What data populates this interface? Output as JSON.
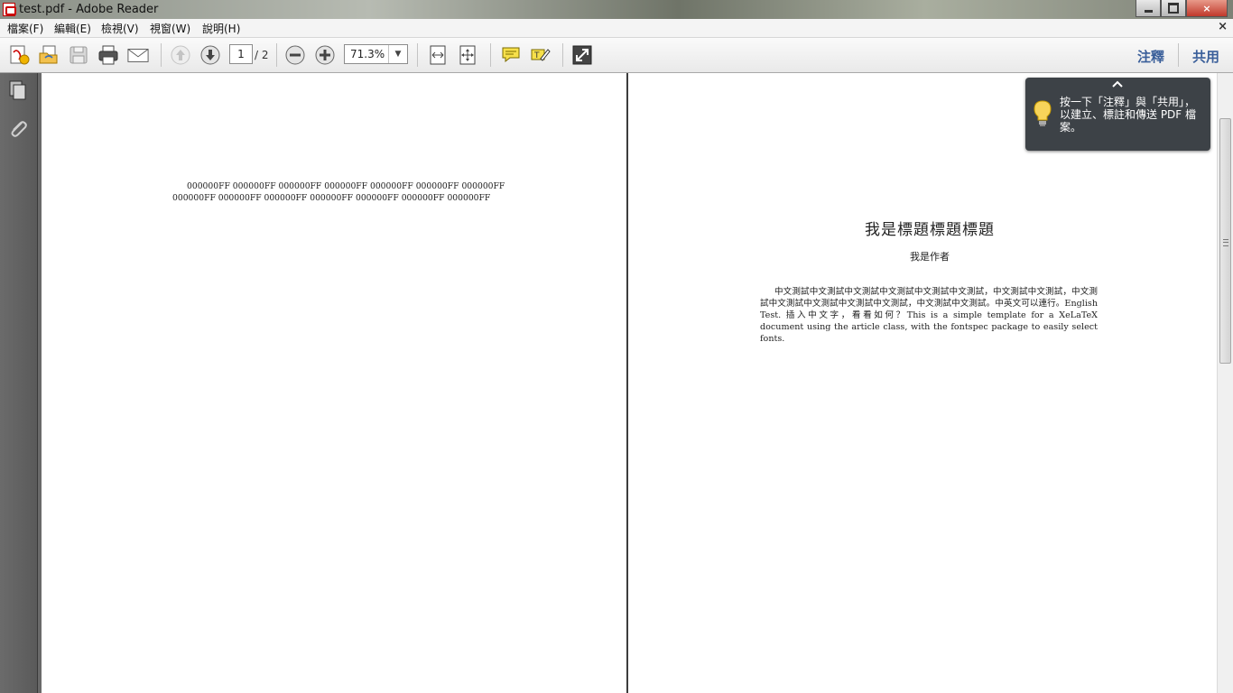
{
  "window": {
    "title": "test.pdf - Adobe Reader",
    "close_glyph": "×"
  },
  "menu": {
    "items": [
      "檔案(F)",
      "編輯(E)",
      "檢視(V)",
      "視窗(W)",
      "說明(H)"
    ],
    "close_glyph": "×"
  },
  "toolbar": {
    "page_current": "1",
    "page_total": "/ 2",
    "zoom": "71.3%",
    "comment_label": "注釋",
    "share_label": "共用",
    "icons": [
      "create-pdf-icon",
      "open-folder-icon",
      "save-icon",
      "print-icon",
      "email-icon",
      "previous-page-icon",
      "next-page-icon",
      "zoom-out-icon",
      "zoom-in-icon",
      "fit-width-icon",
      "fit-page-icon",
      "comment-icon",
      "highlight-icon",
      "full-screen-icon"
    ]
  },
  "navpane": {
    "icons": [
      "pages-icon",
      "attachments-icon"
    ]
  },
  "document": {
    "page1_text": "000000FF 000000FF 000000FF 000000FF 000000FF 000000FF 000000FF 000000FF 000000FF 000000FF 000000FF 000000FF 000000FF 000000FF",
    "page2_title": "我是標題標題標題",
    "page2_author": "我是作者",
    "page2_body": "中文測試中文測試中文測試中文測試中文測試中文測試，中文測試中文測試，中文測試中文測試中文測試中文測試中文測試，中文測試中文測試。中英文可以連行。English Test. 插入中文字，看看如何？This is a simple template for a XeLaTeX document using the article class, with the fontspec package to easily select fonts."
  },
  "tooltip": {
    "text": "按一下「注釋」與「共用」，以建立、標註和傳送 PDF 檔案。",
    "icon": "lightbulb-icon"
  },
  "colors": {
    "link_blue": "#3a5f9a",
    "tooltip_bg": "#3d4247",
    "nav_gray": "#5f5f5f"
  }
}
